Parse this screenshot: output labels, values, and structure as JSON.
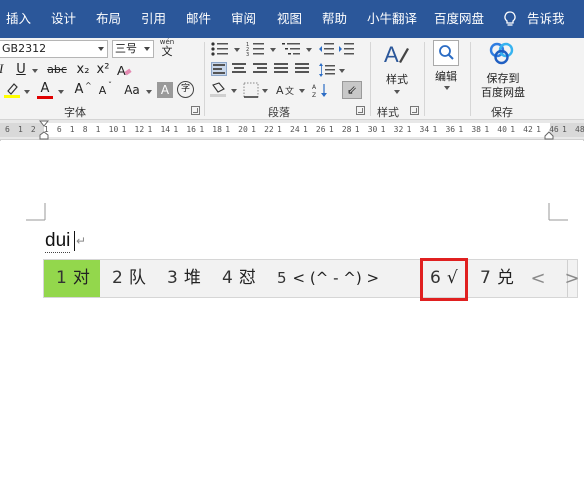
{
  "menu": {
    "items": [
      "插入",
      "设计",
      "布局",
      "引用",
      "邮件",
      "审阅",
      "视图",
      "帮助",
      "小牛翻译",
      "百度网盘"
    ],
    "tell_me": "告诉我"
  },
  "ribbon": {
    "font_name": "GB2312",
    "font_size": "三号",
    "wen_top": "wén",
    "wen_char": "文",
    "groups": {
      "font": "字体",
      "paragraph": "段落",
      "styles": "样式",
      "save": "保存"
    },
    "font_buttons": {
      "underline": "U",
      "strikethrough": "abc",
      "subscript": "x₂",
      "superscript": "x²",
      "font_color": "A",
      "increase_font": "A",
      "decrease_font": "A",
      "change_case": "Aa",
      "char_shading": "A",
      "enclose": "字"
    },
    "styles_button": "样式",
    "editing_button": "编辑",
    "save_button_line1": "保存到",
    "save_button_line2": "百度网盘"
  },
  "ruler": {
    "ticks": [
      "6",
      "1",
      "2",
      "1",
      "6",
      "1",
      "8",
      "1",
      "10",
      "1",
      "12",
      "1",
      "14",
      "1",
      "16",
      "1",
      "18",
      "1",
      "20",
      "1",
      "22",
      "1",
      "24",
      "1",
      "26",
      "1",
      "28",
      "1",
      "30",
      "1",
      "32",
      "1",
      "34",
      "1",
      "36",
      "1",
      "38",
      "1",
      "40",
      "1",
      "42",
      "1",
      "46",
      "1",
      "48"
    ]
  },
  "document": {
    "typed_text": "dui",
    "para_mark": "↵"
  },
  "ime": {
    "candidates": [
      {
        "num": "1",
        "text": "对"
      },
      {
        "num": "2",
        "text": "队"
      },
      {
        "num": "3",
        "text": "堆"
      },
      {
        "num": "4",
        "text": "怼"
      },
      {
        "num": "5",
        "text": "< (^ - ^) >"
      },
      {
        "num": "6",
        "text": "√"
      },
      {
        "num": "7",
        "text": "兑"
      }
    ],
    "prev": "<",
    "next": ">"
  },
  "colors": {
    "menubar": "#2b579a",
    "selected_candidate": "#93d74c",
    "highlight_box": "#e02020",
    "font_color_bar": "#e00000",
    "highlight_bar": "#ffff00"
  }
}
